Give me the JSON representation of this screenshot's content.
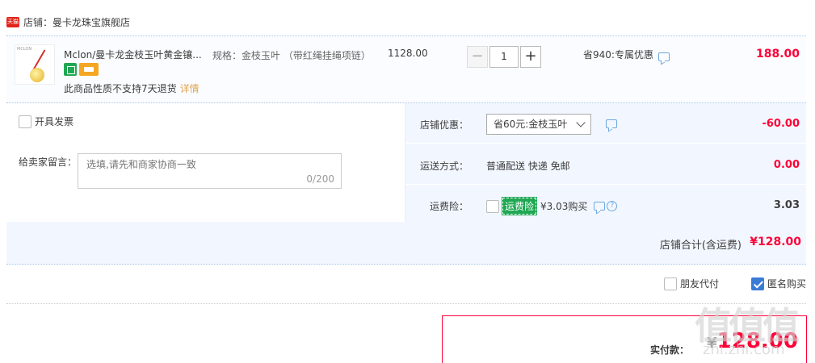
{
  "shop": {
    "tmall_badge": "天猫",
    "label": "店铺：曼卡龙珠宝旗舰店"
  },
  "item": {
    "thumb_brand": "MCLON",
    "title": "Mclon/曼卡龙金枝玉叶黄金镶...",
    "no_return": "此商品性质不支持7天退货",
    "detail_link": "详情",
    "spec": "规格：金枝玉叶 （带红绳挂绳项链）",
    "price": "1128.00",
    "quantity": "1",
    "minus": "−",
    "plus": "+",
    "promo": "省940:专属优惠",
    "subtotal": "188.00"
  },
  "order": {
    "invoice_label": "开具发票",
    "message_label": "给卖家留言：",
    "message_placeholder": "选填,请先和商家协商一致",
    "message_count": "0/200",
    "shop_discount_label": "店铺优惠：",
    "shop_discount_option": "省60元:金枝玉叶",
    "shop_discount_amount": "-60.00",
    "shipping_label": "运送方式：",
    "shipping_value": "普通配送 快递 免邮",
    "shipping_amount": "0.00",
    "insurance_label": "运费险：",
    "insurance_tag": "运费险",
    "insurance_text": "¥3.03购买",
    "insurance_help": "?",
    "insurance_amount": "3.03",
    "total_label": "店铺合计(含运费)",
    "total_value": "¥128.00"
  },
  "options": {
    "friend_pay": "朋友代付",
    "anonymous": "匿名购买"
  },
  "payment": {
    "label": "实付款：",
    "currency": "¥",
    "amount": "128.00"
  },
  "watermark": {
    "logo": "值值值",
    "site": "zhi.zhi.com"
  }
}
